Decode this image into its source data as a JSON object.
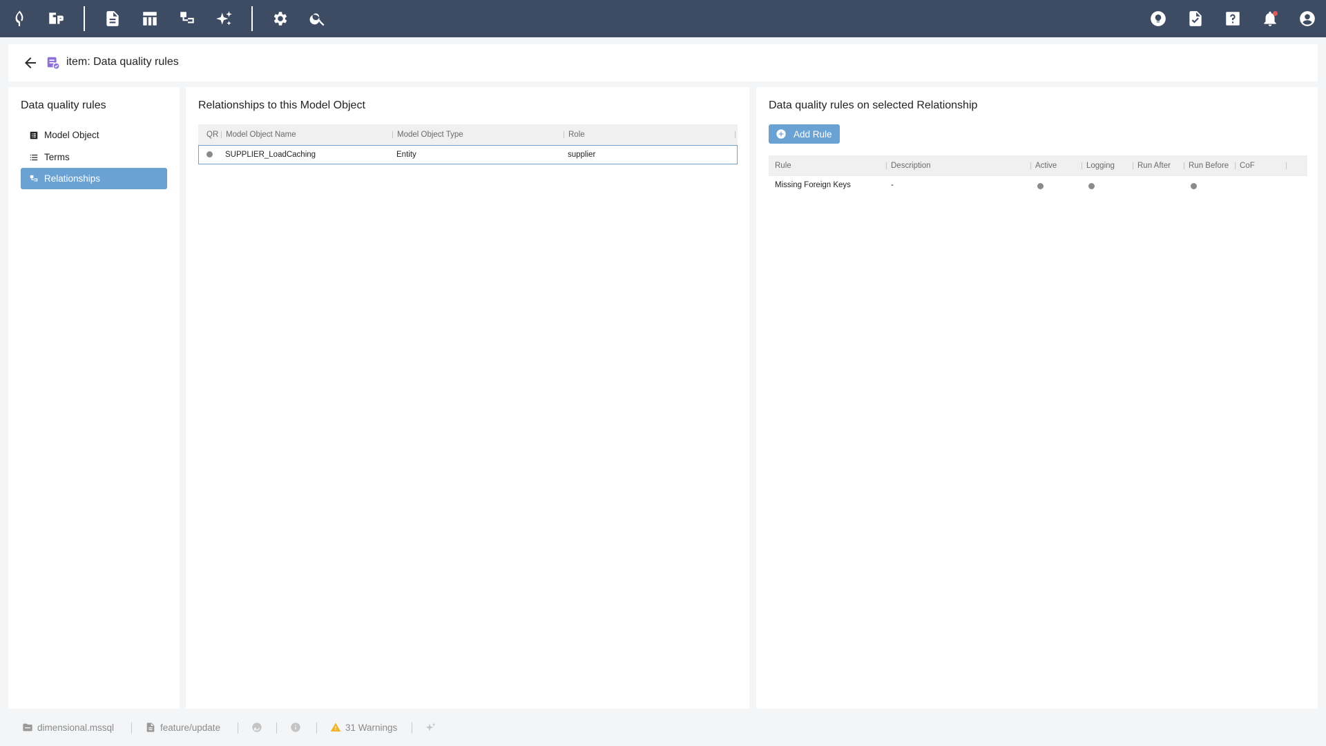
{
  "topbar": {
    "left_icons": [
      "logo-icon",
      "model-icon",
      "document-icon",
      "table-icon",
      "hierarchy-icon",
      "sparkle-icon",
      "gear-icon",
      "search-icon"
    ],
    "right_icons": [
      "lightbulb-icon",
      "file-check-icon",
      "help-icon",
      "bell-icon",
      "account-icon"
    ]
  },
  "header": {
    "title": "item: Data quality rules"
  },
  "left_panel": {
    "title": "Data quality rules",
    "items": [
      {
        "label": "Model Object",
        "icon": "list-box-icon"
      },
      {
        "label": "Terms",
        "icon": "list-icon"
      },
      {
        "label": "Relationships",
        "icon": "hierarchy-icon",
        "active": true
      }
    ]
  },
  "mid_panel": {
    "title": "Relationships to this Model Object",
    "columns": [
      "QR",
      "Model Object Name",
      "Model Object Type",
      "Role"
    ],
    "rows": [
      {
        "qr": "●",
        "name": "SUPPLIER_LoadCaching",
        "type": "Entity",
        "role": "supplier"
      }
    ]
  },
  "right_panel": {
    "title": "Data quality rules on selected Relationship",
    "add_button": "Add Rule",
    "columns": [
      "Rule",
      "Description",
      "Active",
      "Logging",
      "Run After",
      "Run Before",
      "CoF"
    ],
    "rows": [
      {
        "rule": "Missing Foreign Keys",
        "description": "-",
        "active": true,
        "logging": true,
        "run_after": false,
        "run_before": true,
        "cof": false
      }
    ]
  },
  "statusbar": {
    "project": "dimensional.mssql",
    "branch": "feature/update",
    "warnings": "31 Warnings"
  },
  "colors": {
    "topbar": "#3e4c63",
    "accent": "#6aa2d4",
    "warning": "#f0b429"
  }
}
